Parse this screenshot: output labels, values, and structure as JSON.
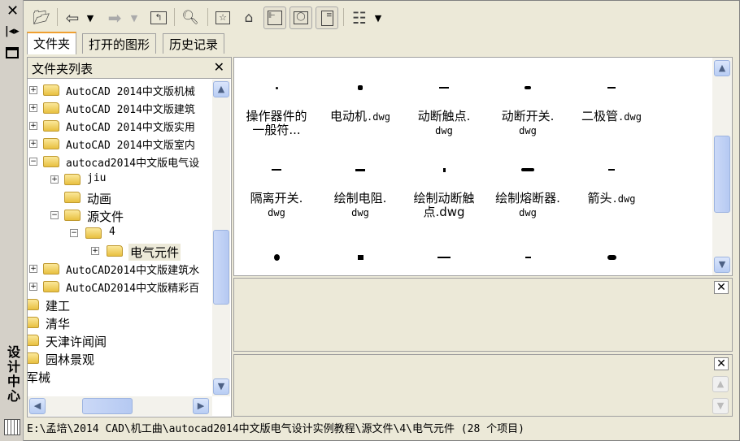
{
  "window_title": "设计中心",
  "toolbar": {
    "buttons": [
      "open-folder",
      "back",
      "back-dropdown",
      "forward",
      "forward-dropdown",
      "up-level",
      "search",
      "favorites",
      "home",
      "tree-view-toggle",
      "preview",
      "description",
      "views",
      "views-dropdown"
    ]
  },
  "tabs": [
    {
      "label": "文件夹",
      "active": true
    },
    {
      "label": "打开的图形",
      "active": false
    },
    {
      "label": "历史记录",
      "active": false
    }
  ],
  "folder_panel": {
    "title": "文件夹列表",
    "tree": [
      {
        "label": "AutoCAD 2014中文版机械",
        "level": 0,
        "exp": "+"
      },
      {
        "label": "AutoCAD 2014中文版建筑",
        "level": 0,
        "exp": "+"
      },
      {
        "label": "AutoCAD 2014中文版实用",
        "level": 0,
        "exp": "+"
      },
      {
        "label": "AutoCAD 2014中文版室内",
        "level": 0,
        "exp": "+"
      },
      {
        "label": "autocad2014中文版电气设",
        "level": 0,
        "exp": "-"
      },
      {
        "label": "jiu",
        "level": 1,
        "exp": "+"
      },
      {
        "label": "动画",
        "level": 1,
        "exp": ""
      },
      {
        "label": "源文件",
        "level": 1,
        "exp": "-"
      },
      {
        "label": "4",
        "level": 2,
        "exp": "-"
      },
      {
        "label": "电气元件",
        "level": 3,
        "exp": "+",
        "selected": true
      },
      {
        "label": "AutoCAD2014中文版建筑水",
        "level": 0,
        "exp": "+"
      },
      {
        "label": "AutoCAD2014中文版精彩百",
        "level": 0,
        "exp": "+"
      },
      {
        "label": "建工",
        "level": -1,
        "exp": ""
      },
      {
        "label": "清华",
        "level": -1,
        "exp": ""
      },
      {
        "label": "天津许闻闻",
        "level": -1,
        "exp": ""
      },
      {
        "label": "园林景观",
        "level": -1,
        "exp": ""
      },
      {
        "label": "军械",
        "level": -2,
        "exp": ""
      }
    ]
  },
  "content_items": [
    {
      "name": "操作器件的",
      "ext": "一般符...",
      "glyph": "cross"
    },
    {
      "name": "电动机",
      "ext": ".dwg",
      "glyph": "motor",
      "inline": true
    },
    {
      "name": "动断触点.",
      "ext": "dwg",
      "glyph": "contact"
    },
    {
      "name": "动断开关.",
      "ext": "dwg",
      "glyph": "switch"
    },
    {
      "name": "二极管",
      "ext": ".dwg",
      "glyph": "diode",
      "inline": true
    },
    {
      "name": "隔离开关.",
      "ext": "dwg",
      "glyph": "isolator"
    },
    {
      "name": "绘制电阻.",
      "ext": "dwg",
      "glyph": "resistor"
    },
    {
      "name": "绘制动断触",
      "ext": "点.dwg",
      "glyph": "dot"
    },
    {
      "name": "绘制熔断器.",
      "ext": "dwg",
      "glyph": "fuse"
    },
    {
      "name": "箭头",
      "ext": ".dwg",
      "glyph": "arrow",
      "inline": true
    },
    {
      "name": "",
      "ext": "",
      "glyph": "circle"
    },
    {
      "name": "",
      "ext": "",
      "glyph": "bars"
    },
    {
      "name": "",
      "ext": "",
      "glyph": "contact2"
    },
    {
      "name": "",
      "ext": "",
      "glyph": "small"
    },
    {
      "name": "",
      "ext": "",
      "glyph": "double"
    }
  ],
  "status_text": "E:\\孟培\\2014 CAD\\机工曲\\autocad2014中文版电气设计实例教程\\源文件\\4\\电气元件 (28 个项目)"
}
